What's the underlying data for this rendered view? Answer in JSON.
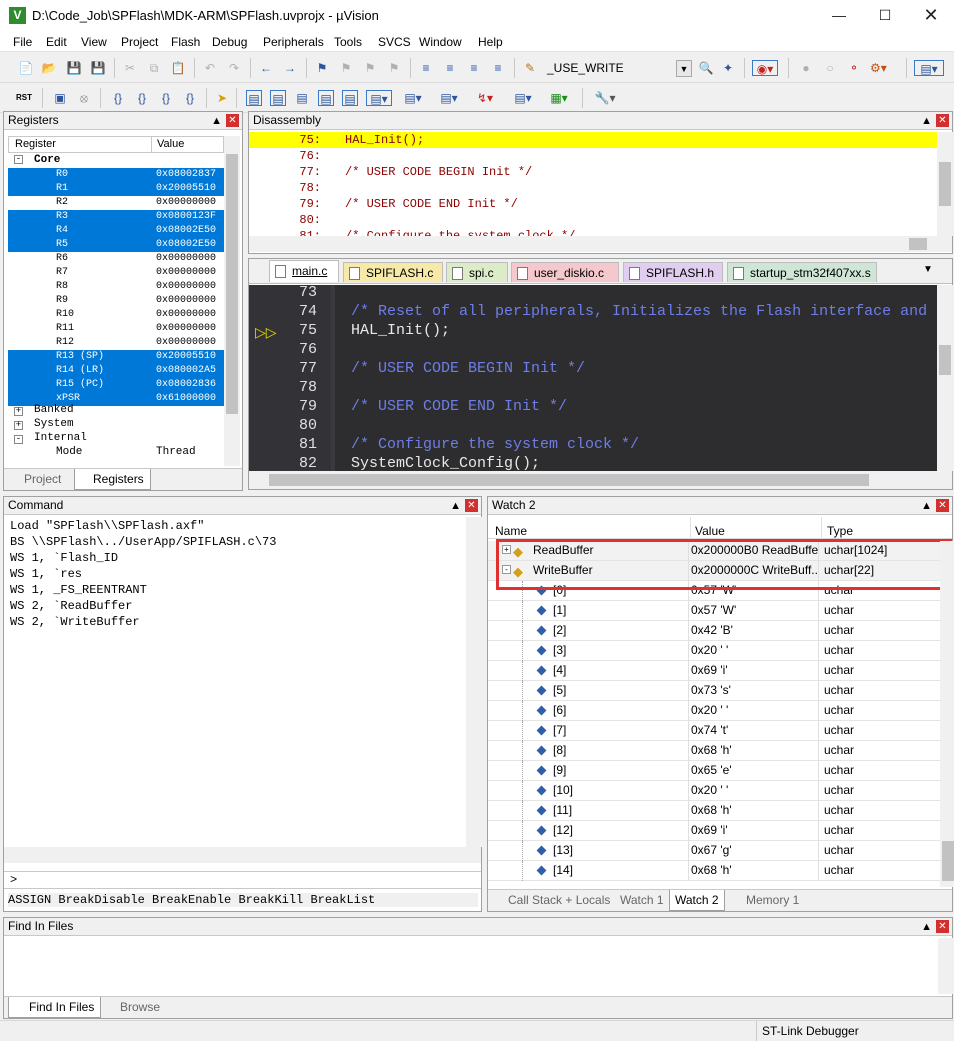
{
  "window": {
    "title": "D:\\Code_Job\\SPFlash\\MDK-ARM\\SPFlash.uvprojx - µVision",
    "app_icon": "V"
  },
  "menu": [
    "File",
    "Edit",
    "View",
    "Project",
    "Flash",
    "Debug",
    "Peripherals",
    "Tools",
    "SVCS",
    "Window",
    "Help"
  ],
  "toolbar": {
    "define_text": "_USE_WRITE"
  },
  "registers": {
    "title": "Registers",
    "col_register": "Register",
    "col_value": "Value",
    "group_core": "Core",
    "rows": [
      {
        "name": "R0",
        "value": "0x08002837",
        "selected": true
      },
      {
        "name": "R1",
        "value": "0x20005510",
        "selected": true
      },
      {
        "name": "R2",
        "value": "0x00000000",
        "selected": false
      },
      {
        "name": "R3",
        "value": "0x0800123F",
        "selected": true
      },
      {
        "name": "R4",
        "value": "0x08002E50",
        "selected": true
      },
      {
        "name": "R5",
        "value": "0x08002E50",
        "selected": true
      },
      {
        "name": "R6",
        "value": "0x00000000",
        "selected": false
      },
      {
        "name": "R7",
        "value": "0x00000000",
        "selected": false
      },
      {
        "name": "R8",
        "value": "0x00000000",
        "selected": false
      },
      {
        "name": "R9",
        "value": "0x00000000",
        "selected": false
      },
      {
        "name": "R10",
        "value": "0x00000000",
        "selected": false
      },
      {
        "name": "R11",
        "value": "0x00000000",
        "selected": false
      },
      {
        "name": "R12",
        "value": "0x00000000",
        "selected": false
      },
      {
        "name": "R13 (SP)",
        "value": "0x20005510",
        "selected": true
      },
      {
        "name": "R14 (LR)",
        "value": "0x080002A5",
        "selected": true
      },
      {
        "name": "R15 (PC)",
        "value": "0x08002836",
        "selected": true
      },
      {
        "name": "xPSR",
        "value": "0x61000000",
        "selected": true
      }
    ],
    "groups": [
      "Banked",
      "System",
      "Internal"
    ],
    "mode_name": "Mode",
    "mode_value": "Thread",
    "tab_project": "Project",
    "tab_registers": "Registers"
  },
  "disassembly": {
    "title": "Disassembly",
    "lines": [
      {
        "num": "75:",
        "code": "HAL_Init();",
        "hl": true
      },
      {
        "num": "76:",
        "code": "",
        "hl": false
      },
      {
        "num": "77:",
        "code": "/* USER CODE BEGIN Init */",
        "hl": false
      },
      {
        "num": "78:",
        "code": "",
        "hl": false
      },
      {
        "num": "79:",
        "code": "/* USER CODE END Init */",
        "hl": false
      },
      {
        "num": "80:",
        "code": "",
        "hl": false
      },
      {
        "num": "81:",
        "code": "/* Configure the system clock */",
        "hl": false
      }
    ]
  },
  "editor": {
    "tabs": [
      {
        "label": "main.c",
        "color": "#ffffff"
      },
      {
        "label": "SPIFLASH.c",
        "color": "#f7e9a8"
      },
      {
        "label": "spi.c",
        "color": "#dcecc8"
      },
      {
        "label": "user_diskio.c",
        "color": "#f4c8cc"
      },
      {
        "label": "SPIFLASH.h",
        "color": "#e0cdf0"
      },
      {
        "label": "startup_stm32f407xx.s",
        "color": "#cfe6d6"
      }
    ],
    "lines": [
      {
        "num": "73",
        "code": "",
        "type": "plain"
      },
      {
        "num": "74",
        "code": "/* Reset of all peripherals, Initializes the Flash interface and",
        "type": "comment"
      },
      {
        "num": "75",
        "code": "HAL_Init();",
        "type": "plain"
      },
      {
        "num": "76",
        "code": "",
        "type": "plain"
      },
      {
        "num": "77",
        "code": "/* USER CODE BEGIN Init */",
        "type": "comment"
      },
      {
        "num": "78",
        "code": "",
        "type": "plain"
      },
      {
        "num": "79",
        "code": "/* USER CODE END Init */",
        "type": "comment"
      },
      {
        "num": "80",
        "code": "",
        "type": "plain"
      },
      {
        "num": "81",
        "code": "/* Configure the system clock */",
        "type": "comment"
      },
      {
        "num": "82",
        "code": "SystemClock_Config();",
        "type": "plain"
      }
    ]
  },
  "command": {
    "title": "Command",
    "lines": [
      "Load \"SPFlash\\\\SPFlash.axf\"",
      "BS \\\\SPFlash\\../UserApp/SPIFLASH.c\\73",
      "WS 1, `Flash_ID",
      "WS 1, `res",
      "WS 1, _FS_REENTRANT",
      "WS 2, `ReadBuffer",
      "WS 2, `WriteBuffer"
    ],
    "prompt": ">",
    "hint": "ASSIGN BreakDisable BreakEnable BreakKill BreakList"
  },
  "watch": {
    "title": "Watch 2",
    "col_name": "Name",
    "col_value": "Value",
    "col_type": "Type",
    "top_rows": [
      {
        "name": "ReadBuffer",
        "value": "0x200000B0 ReadBuffe...",
        "type": "uchar[1024]"
      },
      {
        "name": "WriteBuffer",
        "value": "0x2000000C WriteBuff...",
        "type": "uchar[22]"
      }
    ],
    "items": [
      {
        "name": "[0]",
        "value": "0x57 'W'",
        "type": "uchar"
      },
      {
        "name": "[1]",
        "value": "0x57 'W'",
        "type": "uchar"
      },
      {
        "name": "[2]",
        "value": "0x42 'B'",
        "type": "uchar"
      },
      {
        "name": "[3]",
        "value": "0x20 ' '",
        "type": "uchar"
      },
      {
        "name": "[4]",
        "value": "0x69 'i'",
        "type": "uchar"
      },
      {
        "name": "[5]",
        "value": "0x73 's'",
        "type": "uchar"
      },
      {
        "name": "[6]",
        "value": "0x20 ' '",
        "type": "uchar"
      },
      {
        "name": "[7]",
        "value": "0x74 't'",
        "type": "uchar"
      },
      {
        "name": "[8]",
        "value": "0x68 'h'",
        "type": "uchar"
      },
      {
        "name": "[9]",
        "value": "0x65 'e'",
        "type": "uchar"
      },
      {
        "name": "[10]",
        "value": "0x20 ' '",
        "type": "uchar"
      },
      {
        "name": "[11]",
        "value": "0x68 'h'",
        "type": "uchar"
      },
      {
        "name": "[12]",
        "value": "0x69 'i'",
        "type": "uchar"
      },
      {
        "name": "[13]",
        "value": "0x67 'g'",
        "type": "uchar"
      },
      {
        "name": "[14]",
        "value": "0x68 'h'",
        "type": "uchar"
      }
    ],
    "tabs": [
      "Call Stack + Locals",
      "Watch 1",
      "Watch 2",
      "Memory 1"
    ]
  },
  "find": {
    "title": "Find In Files",
    "tab_find": "Find In Files",
    "tab_browse": "Browse"
  },
  "status": {
    "debugger": "ST-Link Debugger"
  },
  "colors": {
    "selection": "#0078d7",
    "highlight": "#ffff00",
    "editor_bg": "#2d2d30",
    "comment": "#6d7ee8",
    "callout": "#e03030"
  }
}
